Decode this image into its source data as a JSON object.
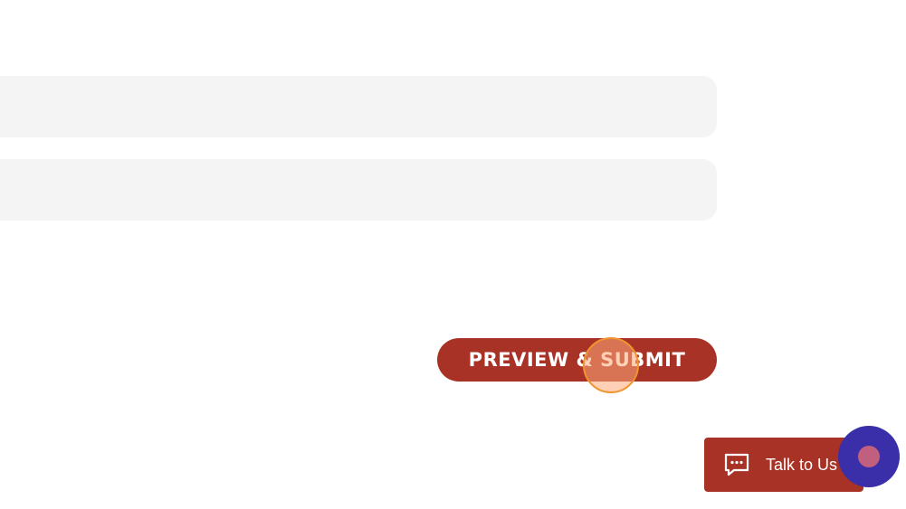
{
  "form": {
    "field_1_value": "",
    "field_2_value": "",
    "submit_label": "PREVIEW & SUBMIT"
  },
  "chat": {
    "label": "Talk to Us",
    "icon": "chat-bubble-icon"
  },
  "launcher": {
    "icon": "assistant-launcher-icon"
  },
  "colors": {
    "brand_red": "#a93226",
    "field_bg": "#f4f4f4",
    "launcher_bg": "#3a2fa8",
    "launcher_dot": "#c1607e",
    "click_marker": "#f0952e"
  }
}
